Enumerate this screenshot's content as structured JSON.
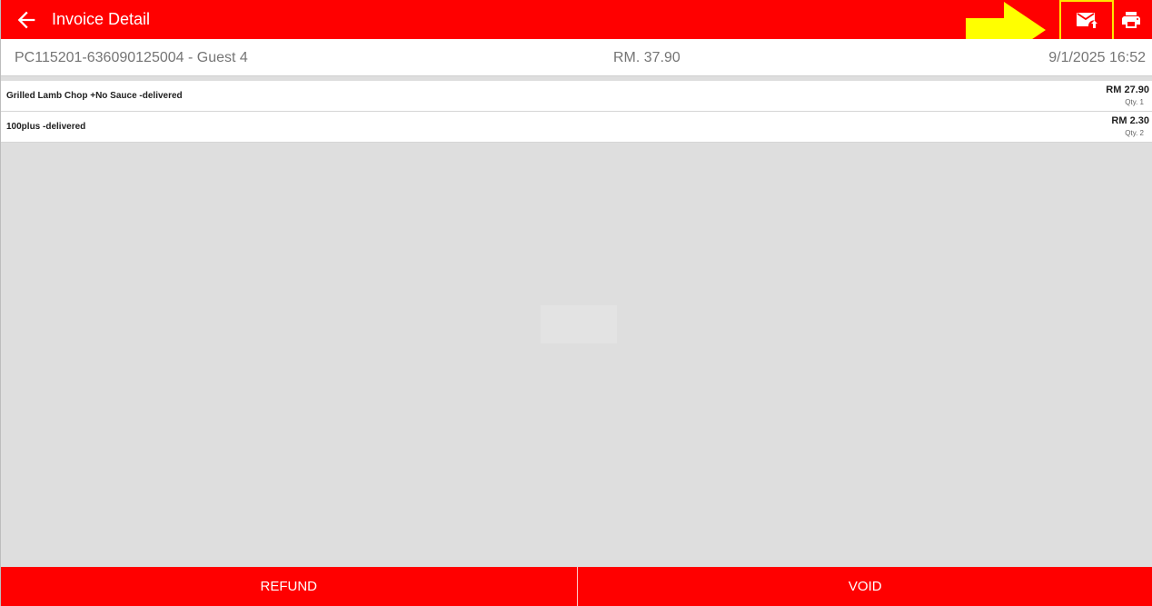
{
  "header": {
    "title": "Invoice Detail"
  },
  "invoice": {
    "number": "PC115201-636090125004 - Guest 4",
    "amount": "RM. 37.90",
    "datetime": "9/1/2025 16:52"
  },
  "items": [
    {
      "name": "Grilled Lamb Chop  +No Sauce -delivered",
      "price": "RM 27.90",
      "qty": "Qty. 1"
    },
    {
      "name": "100plus  -delivered",
      "price": "RM 2.30",
      "qty": "Qty. 2"
    }
  ],
  "actions": {
    "refund_label": "REFUND",
    "void_label": "VOID"
  },
  "icons": {
    "back": "arrow-left-icon",
    "email": "email-send-icon",
    "print": "printer-icon"
  },
  "colors": {
    "primary": "#ff0000",
    "highlight": "#ffe600",
    "background": "#dedede"
  }
}
